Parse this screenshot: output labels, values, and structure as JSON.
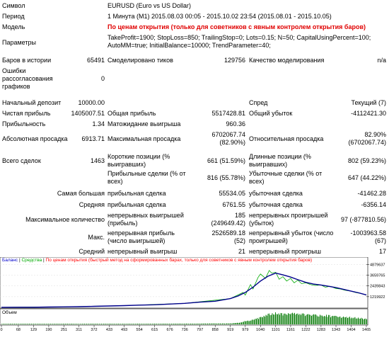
{
  "report": {
    "symbol_label": "Символ",
    "symbol_value": "EURUSD (Euro vs US Dollar)",
    "period_label": "Период",
    "period_value": "1 Минута (M1) 2015.08.03 00:05 - 2015.10.02 23:54 (2015.08.01 - 2015.10.05)",
    "model_label": "Модель",
    "model_value": "По ценам открытия (только для советников с явным контролем открытия баров)",
    "params_label": "Параметры",
    "params_line1": "TakeProfit=1900; StopLoss=850; TrailingStop=0; Lots=0.15; N=50; CapitalUsingPercent=100;",
    "params_line2": "AutoMM=true; InitialBalance=10000; TrendParameter=40;",
    "bars_label": "Баров в истории",
    "bars_value": "65491",
    "ticks_label": "Смоделировано тиков",
    "ticks_value": "129756",
    "quality_label": "Качество моделирования",
    "quality_value": "n/a",
    "errors_label": "Ошибки рассогласования графиков",
    "errors_value": "0",
    "deposit_label": "Начальный депозит",
    "deposit_value": "10000.00",
    "spread_label": "Спред",
    "spread_value": "Текущий (7)",
    "net_profit_label": "Чистая прибыль",
    "net_profit_value": "1405007.51",
    "gross_profit_label": "Общая прибыль",
    "gross_profit_value": "5517428.81",
    "gross_loss_label": "Общий убыток",
    "gross_loss_value": "-4112421.30",
    "profit_factor_label": "Прибыльность",
    "profit_factor_value": "1.34",
    "expected_payoff_label": "Матожидание выигрыша",
    "expected_payoff_value": "960.36",
    "abs_dd_label": "Абсолютная просадка",
    "abs_dd_value": "6913.71",
    "max_dd_label": "Максимальная просадка",
    "max_dd_value1": "6702067.74",
    "max_dd_value2": "(82.90%)",
    "rel_dd_label": "Относительная просадка",
    "rel_dd_value1": "82.90%",
    "rel_dd_value2": "(6702067.74)",
    "total_trades_label": "Всего сделок",
    "total_trades_value": "1463",
    "short_label": "Короткие позиции (% выигравших)",
    "short_value": "661 (51.59%)",
    "long_label": "Длинные позиции (% выигравших)",
    "long_value": "802 (59.23%)",
    "profit_trades_label": "Прибыльные сделки (% от всех)",
    "profit_trades_value": "816 (55.78%)",
    "loss_trades_label": "Убыточные сделки (% от всех)",
    "loss_trades_value": "647 (44.22%)",
    "largest_label": "Самая большая",
    "largest_profit_label": "прибыльная сделка",
    "largest_profit_value": "55534.05",
    "largest_loss_label": "убыточная сделка",
    "largest_loss_value": "-41462.28",
    "average_label": "Средняя",
    "average_profit_label": "прибыльная сделка",
    "average_profit_value": "6761.55",
    "average_loss_label": "убыточная сделка",
    "average_loss_value": "-6356.14",
    "max_count_label": "Максимальное количество",
    "max_cons_wins_label": "непрерывных выигрышей (прибыль)",
    "max_cons_wins_value1": "185",
    "max_cons_wins_value2": "(249649.42)",
    "max_cons_losses_label": "непрерывных проигрышей (убыток)",
    "max_cons_losses_value": "97 (-877810.56)",
    "max_label": "Макс.",
    "max_cons_profit_label": "непрерывная прибыль (число выигрышей)",
    "max_cons_profit_value1": "2526589.18",
    "max_cons_profit_value2": "(52)",
    "max_cons_loss_label": "непрерывный убыток (число проигрышей)",
    "max_cons_loss_value1": "-1003963.58",
    "max_cons_loss_value2": "(67)",
    "avg_label": "Средний",
    "avg_cons_wins_label": "непрерывный выигрыш",
    "avg_cons_wins_value": "21",
    "avg_cons_losses_label": "непрерывный проигрыш",
    "avg_cons_losses_value": "17"
  },
  "chart_data": {
    "type": "line",
    "legend": {
      "balance": "Баланс",
      "equity": "Средства",
      "note": "По ценам открытия (быстрый метод на сформированных барах, только для советников с явным контролем открытия баров)"
    },
    "volume_title": "Объем",
    "y_ticks": [
      "4879637",
      "3659765",
      "2439843",
      "1219922"
    ],
    "x_ticks": [
      "0",
      "68",
      "129",
      "190",
      "251",
      "311",
      "372",
      "433",
      "493",
      "554",
      "615",
      "676",
      "736",
      "797",
      "858",
      "919",
      "979",
      "1040",
      "1101",
      "1161",
      "1222",
      "1283",
      "1343",
      "1404",
      "1465"
    ],
    "x_range": [
      0,
      1465
    ],
    "y_range": [
      0,
      5000000
    ],
    "colors": {
      "balance": "#00008b",
      "equity": "#00aa00",
      "volume": "#108010",
      "note": "#ff0000"
    },
    "balance": [
      [
        0,
        10000
      ],
      [
        68,
        15000
      ],
      [
        129,
        20000
      ],
      [
        190,
        40000
      ],
      [
        251,
        60000
      ],
      [
        311,
        80000
      ],
      [
        372,
        120000
      ],
      [
        433,
        160000
      ],
      [
        493,
        200000
      ],
      [
        554,
        260000
      ],
      [
        615,
        300000
      ],
      [
        676,
        380000
      ],
      [
        736,
        460000
      ],
      [
        797,
        600000
      ],
      [
        858,
        700000
      ],
      [
        919,
        1000000
      ],
      [
        950,
        1300000
      ],
      [
        979,
        1700000
      ],
      [
        1010,
        2300000
      ],
      [
        1040,
        3000000
      ],
      [
        1070,
        3550000
      ],
      [
        1101,
        3900000
      ],
      [
        1130,
        3700000
      ],
      [
        1161,
        3450000
      ],
      [
        1190,
        3150000
      ],
      [
        1222,
        2850000
      ],
      [
        1253,
        2650000
      ],
      [
        1283,
        2550000
      ],
      [
        1313,
        2400000
      ],
      [
        1343,
        2250000
      ],
      [
        1374,
        2050000
      ],
      [
        1404,
        1850000
      ],
      [
        1435,
        1650000
      ],
      [
        1465,
        1420000
      ]
    ],
    "equity": [
      [
        0,
        10000
      ],
      [
        251,
        60000
      ],
      [
        493,
        200000
      ],
      [
        736,
        460000
      ],
      [
        919,
        1000000
      ],
      [
        970,
        1700000
      ],
      [
        979,
        1400000
      ],
      [
        1000,
        2600000
      ],
      [
        1010,
        2100000
      ],
      [
        1030,
        3400000
      ],
      [
        1040,
        3800000
      ],
      [
        1060,
        3300000
      ],
      [
        1075,
        4200000
      ],
      [
        1085,
        3900000
      ],
      [
        1101,
        4000000
      ],
      [
        1115,
        3200000
      ],
      [
        1130,
        3500000
      ],
      [
        1145,
        3000000
      ],
      [
        1161,
        3300000
      ],
      [
        1175,
        2800000
      ],
      [
        1190,
        3100000
      ],
      [
        1205,
        2700000
      ],
      [
        1222,
        2800000
      ],
      [
        1240,
        2600000
      ],
      [
        1260,
        2500000
      ],
      [
        1283,
        2550000
      ],
      [
        1300,
        2300000
      ],
      [
        1320,
        2400000
      ],
      [
        1343,
        2150000
      ],
      [
        1360,
        2100000
      ],
      [
        1380,
        1950000
      ],
      [
        1404,
        1850000
      ],
      [
        1420,
        1700000
      ],
      [
        1440,
        1600000
      ],
      [
        1465,
        1400000
      ]
    ],
    "volume": [
      [
        0,
        0.05
      ],
      [
        251,
        0.05
      ],
      [
        493,
        0.05
      ],
      [
        736,
        0.06
      ],
      [
        919,
        0.08
      ],
      [
        960,
        0.15
      ],
      [
        979,
        0.3
      ],
      [
        1000,
        0.35
      ],
      [
        1040,
        0.6
      ],
      [
        1070,
        0.85
      ],
      [
        1101,
        1.0
      ],
      [
        1130,
        0.9
      ],
      [
        1161,
        0.95
      ],
      [
        1222,
        0.85
      ],
      [
        1283,
        0.8
      ],
      [
        1343,
        0.7
      ],
      [
        1404,
        0.6
      ],
      [
        1465,
        0.5
      ]
    ]
  }
}
